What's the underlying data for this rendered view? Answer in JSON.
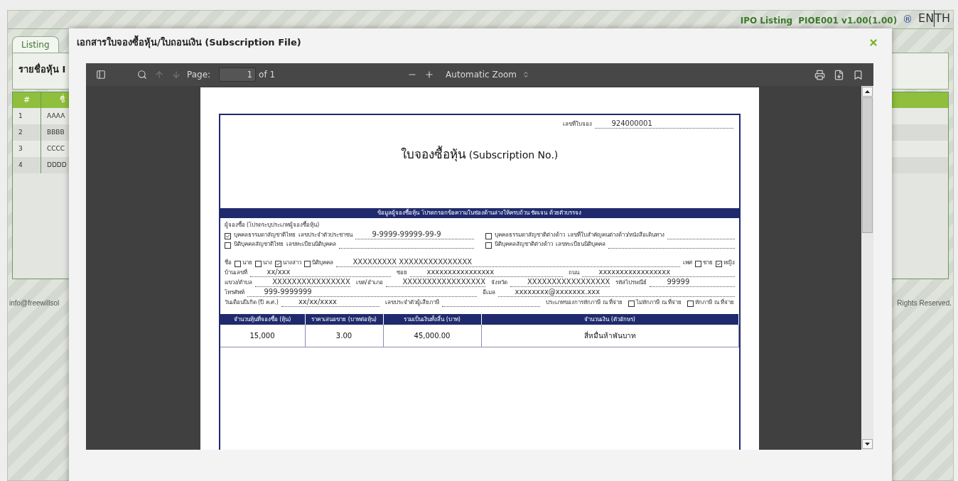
{
  "header": {
    "app": "IPO Listing",
    "version": "PIOE001 v1.00(1.00)",
    "registered": "®",
    "languages": [
      "EN",
      "TH"
    ]
  },
  "tabs": [
    {
      "label": "Listing",
      "selected": true
    }
  ],
  "panel_title": "รายชื่อหุ้น I",
  "table": {
    "columns": [
      "#",
      "ชื่"
    ],
    "rows": [
      [
        "1",
        "AAAA"
      ],
      [
        "2",
        "BBBB"
      ],
      [
        "3",
        "CCCC"
      ],
      [
        "4",
        "DDDD"
      ]
    ]
  },
  "footer": {
    "left": "info@freewillsol",
    "right": "Rights Reserved."
  },
  "dialog": {
    "title": "เอกสารใบจองซื้อหุ้น/ใบถอนเงิน (Subscription File)",
    "viewer": {
      "page_label": "Page:",
      "page": "1",
      "page_count": "of 1",
      "zoom": "Automatic Zoom"
    },
    "document": {
      "number_label": "เลขที่ใบจอง",
      "number": "924000001",
      "title": "ใบจองซื้อหุ้น",
      "title_en": "(Subscription No.)",
      "section_header": "ข้อมูลผู้จองซื้อหุ้น โปรดกรอกข้อความในช่องด้านล่างให้ครบถ้วน ชัดเจน ด้วยตัวบรรจง",
      "subscriber_label": "ผู้จองซื้อ (โปรดระบุประเภทผู้จองซื้อหุ้น)",
      "subscriber_types": [
        {
          "label": "บุคคลธรรมดาสัญชาติไทย",
          "checked": true,
          "id_label": "เลขประจำตัวประชาชน",
          "id_value": "9-9999-99999-99-9"
        },
        {
          "label": "บุคคลธรรมดาสัญชาติต่างด้าว",
          "checked": false,
          "id_label": "เลขที่ใบสำคัญคนต่างด้าว/หนังสือเดินทาง"
        },
        {
          "label": "นิติบุคคลสัญชาติไทย",
          "checked": false,
          "id_label": "เลขทะเบียนนิติบุคคล"
        },
        {
          "label": "นิติบุคคลสัญชาติต่างด้าว",
          "checked": false,
          "id_label": "เลขทะเบียนนิติบุคคล"
        }
      ],
      "name_label": "ชื่อ",
      "titles": [
        {
          "label": "นาย",
          "checked": false
        },
        {
          "label": "นาง",
          "checked": false
        },
        {
          "label": "นางสาว",
          "checked": true
        },
        {
          "label": "นิติบุคคล",
          "checked": false
        }
      ],
      "name": "XXXXXXXXX  XXXXXXXXXXXXXXX",
      "gender_label": "เพศ",
      "genders": [
        {
          "label": "ชาย",
          "checked": false
        },
        {
          "label": "หญิง",
          "checked": true
        }
      ],
      "field_rows": [
        [
          {
            "label": "บ้านเลขที่",
            "value": "xx/xxx"
          },
          {
            "label": "ซอย",
            "value": "xxxxxxxxxxxxxxxx"
          },
          {
            "label": "ถนน",
            "value": "xxxxxxxxxxxxxxxxx"
          }
        ],
        [
          {
            "label": "แขวง/ตำบล",
            "value": "XXXXXXXXXXXXXXXX"
          },
          {
            "label": "เขต/อำเภอ",
            "value": "XXXXXXXXXXXXXXXXX"
          },
          {
            "label": "จังหวัด",
            "value": "XXXXXXXXXXXXXXXXX"
          },
          {
            "label": "รหัสไปรษณีย์",
            "value": "99999"
          }
        ],
        [
          {
            "label": "โทรศัพท์",
            "value": "999-9999999"
          },
          {
            "label": "อีเมล",
            "value": "xxxxxxxx@xxxxxxx.xxx"
          }
        ],
        [
          {
            "label": "วันเดือนปีเกิด (ปี ค.ศ.)",
            "value": "xx/xx/xxxx"
          },
          {
            "label": "เลขประจำตัวผู้เสียภาษี"
          }
        ]
      ],
      "tax_label": "ประเภทของการหักภาษี ณ ที่จ่าย",
      "tax_options": [
        {
          "label": "ไม่หักภาษี ณ ที่จ่าย",
          "checked": false
        },
        {
          "label": "หักภาษี ณ ที่จ่าย",
          "checked": false
        }
      ],
      "amount_columns": [
        "จำนวนหุ้นที่จองซื้อ (หุ้น)",
        "ราคาเสนอขาย (บาทต่อหุ้น)",
        "รวมเป็นเงินทั้งสิ้น (บาท)",
        "จำนวนเงิน (ตัวอักษร)"
      ],
      "amount_row": [
        "15,000",
        "3.00",
        "45,000.00",
        "สี่หมื่นห้าพันบาท"
      ]
    }
  }
}
